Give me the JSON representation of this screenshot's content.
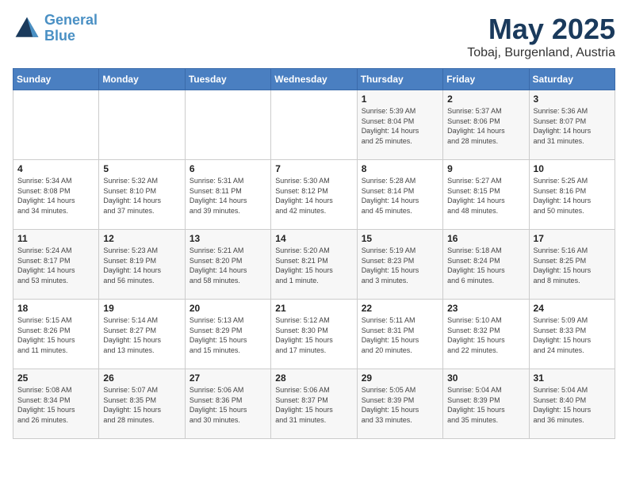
{
  "logo": {
    "line1": "General",
    "line2": "Blue"
  },
  "title": "May 2025",
  "subtitle": "Tobaj, Burgenland, Austria",
  "weekdays": [
    "Sunday",
    "Monday",
    "Tuesday",
    "Wednesday",
    "Thursday",
    "Friday",
    "Saturday"
  ],
  "weeks": [
    [
      {
        "day": "",
        "info": ""
      },
      {
        "day": "",
        "info": ""
      },
      {
        "day": "",
        "info": ""
      },
      {
        "day": "",
        "info": ""
      },
      {
        "day": "1",
        "info": "Sunrise: 5:39 AM\nSunset: 8:04 PM\nDaylight: 14 hours\nand 25 minutes."
      },
      {
        "day": "2",
        "info": "Sunrise: 5:37 AM\nSunset: 8:06 PM\nDaylight: 14 hours\nand 28 minutes."
      },
      {
        "day": "3",
        "info": "Sunrise: 5:36 AM\nSunset: 8:07 PM\nDaylight: 14 hours\nand 31 minutes."
      }
    ],
    [
      {
        "day": "4",
        "info": "Sunrise: 5:34 AM\nSunset: 8:08 PM\nDaylight: 14 hours\nand 34 minutes."
      },
      {
        "day": "5",
        "info": "Sunrise: 5:32 AM\nSunset: 8:10 PM\nDaylight: 14 hours\nand 37 minutes."
      },
      {
        "day": "6",
        "info": "Sunrise: 5:31 AM\nSunset: 8:11 PM\nDaylight: 14 hours\nand 39 minutes."
      },
      {
        "day": "7",
        "info": "Sunrise: 5:30 AM\nSunset: 8:12 PM\nDaylight: 14 hours\nand 42 minutes."
      },
      {
        "day": "8",
        "info": "Sunrise: 5:28 AM\nSunset: 8:14 PM\nDaylight: 14 hours\nand 45 minutes."
      },
      {
        "day": "9",
        "info": "Sunrise: 5:27 AM\nSunset: 8:15 PM\nDaylight: 14 hours\nand 48 minutes."
      },
      {
        "day": "10",
        "info": "Sunrise: 5:25 AM\nSunset: 8:16 PM\nDaylight: 14 hours\nand 50 minutes."
      }
    ],
    [
      {
        "day": "11",
        "info": "Sunrise: 5:24 AM\nSunset: 8:17 PM\nDaylight: 14 hours\nand 53 minutes."
      },
      {
        "day": "12",
        "info": "Sunrise: 5:23 AM\nSunset: 8:19 PM\nDaylight: 14 hours\nand 56 minutes."
      },
      {
        "day": "13",
        "info": "Sunrise: 5:21 AM\nSunset: 8:20 PM\nDaylight: 14 hours\nand 58 minutes."
      },
      {
        "day": "14",
        "info": "Sunrise: 5:20 AM\nSunset: 8:21 PM\nDaylight: 15 hours\nand 1 minute."
      },
      {
        "day": "15",
        "info": "Sunrise: 5:19 AM\nSunset: 8:23 PM\nDaylight: 15 hours\nand 3 minutes."
      },
      {
        "day": "16",
        "info": "Sunrise: 5:18 AM\nSunset: 8:24 PM\nDaylight: 15 hours\nand 6 minutes."
      },
      {
        "day": "17",
        "info": "Sunrise: 5:16 AM\nSunset: 8:25 PM\nDaylight: 15 hours\nand 8 minutes."
      }
    ],
    [
      {
        "day": "18",
        "info": "Sunrise: 5:15 AM\nSunset: 8:26 PM\nDaylight: 15 hours\nand 11 minutes."
      },
      {
        "day": "19",
        "info": "Sunrise: 5:14 AM\nSunset: 8:27 PM\nDaylight: 15 hours\nand 13 minutes."
      },
      {
        "day": "20",
        "info": "Sunrise: 5:13 AM\nSunset: 8:29 PM\nDaylight: 15 hours\nand 15 minutes."
      },
      {
        "day": "21",
        "info": "Sunrise: 5:12 AM\nSunset: 8:30 PM\nDaylight: 15 hours\nand 17 minutes."
      },
      {
        "day": "22",
        "info": "Sunrise: 5:11 AM\nSunset: 8:31 PM\nDaylight: 15 hours\nand 20 minutes."
      },
      {
        "day": "23",
        "info": "Sunrise: 5:10 AM\nSunset: 8:32 PM\nDaylight: 15 hours\nand 22 minutes."
      },
      {
        "day": "24",
        "info": "Sunrise: 5:09 AM\nSunset: 8:33 PM\nDaylight: 15 hours\nand 24 minutes."
      }
    ],
    [
      {
        "day": "25",
        "info": "Sunrise: 5:08 AM\nSunset: 8:34 PM\nDaylight: 15 hours\nand 26 minutes."
      },
      {
        "day": "26",
        "info": "Sunrise: 5:07 AM\nSunset: 8:35 PM\nDaylight: 15 hours\nand 28 minutes."
      },
      {
        "day": "27",
        "info": "Sunrise: 5:06 AM\nSunset: 8:36 PM\nDaylight: 15 hours\nand 30 minutes."
      },
      {
        "day": "28",
        "info": "Sunrise: 5:06 AM\nSunset: 8:37 PM\nDaylight: 15 hours\nand 31 minutes."
      },
      {
        "day": "29",
        "info": "Sunrise: 5:05 AM\nSunset: 8:39 PM\nDaylight: 15 hours\nand 33 minutes."
      },
      {
        "day": "30",
        "info": "Sunrise: 5:04 AM\nSunset: 8:39 PM\nDaylight: 15 hours\nand 35 minutes."
      },
      {
        "day": "31",
        "info": "Sunrise: 5:04 AM\nSunset: 8:40 PM\nDaylight: 15 hours\nand 36 minutes."
      }
    ]
  ]
}
